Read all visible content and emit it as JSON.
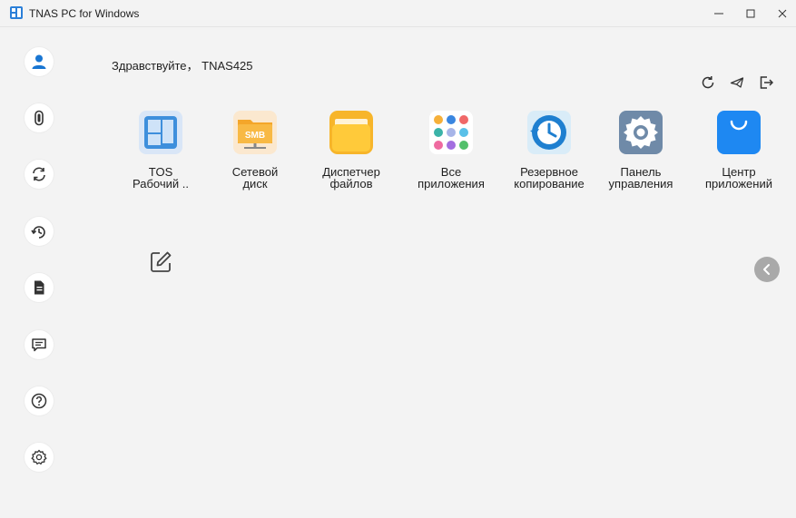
{
  "window": {
    "title": "TNAS PC for Windows",
    "minimize_icon": "minimize-icon",
    "maximize_icon": "maximize-icon",
    "close_icon": "close-icon"
  },
  "sidebar": {
    "items": [
      {
        "name": "user",
        "icon": "user-icon"
      },
      {
        "name": "tnas-device",
        "icon": "device-icon"
      },
      {
        "name": "sync",
        "icon": "sync-icon"
      },
      {
        "name": "backup",
        "icon": "backup-icon"
      },
      {
        "name": "files",
        "icon": "document-icon"
      },
      {
        "name": "messages",
        "icon": "message-icon"
      },
      {
        "name": "help",
        "icon": "help-icon"
      },
      {
        "name": "settings",
        "icon": "gear-icon"
      }
    ]
  },
  "header": {
    "greeting": "Здравствуйте， TNAS425",
    "actions": [
      "refresh-icon",
      "send-icon",
      "logout-icon"
    ]
  },
  "apps": [
    {
      "label": "TOS\nРабочий ..",
      "icon": "tos-desktop-icon"
    },
    {
      "label": "Сетевой\nдиск",
      "icon": "smb-icon"
    },
    {
      "label": "Диспетчер\nфайлов",
      "icon": "folder-icon"
    },
    {
      "label": "Все\nприложения",
      "icon": "all-apps-icon"
    },
    {
      "label": "Резервное\nкопирование",
      "icon": "backup-clock-icon"
    },
    {
      "label": "Панель\nуправления",
      "icon": "control-panel-icon"
    },
    {
      "label": "Центр\nприложений",
      "icon": "app-center-icon"
    }
  ],
  "smb_badge": "SMB",
  "colors": {
    "background": "#f3f3f3",
    "accent_blue": "#1976d2",
    "folder_yellow": "#ffc93c",
    "app_center_blue": "#1e88f2",
    "panel_gray": "#6f8aa8",
    "arrow_gray": "#a9a9a9"
  }
}
